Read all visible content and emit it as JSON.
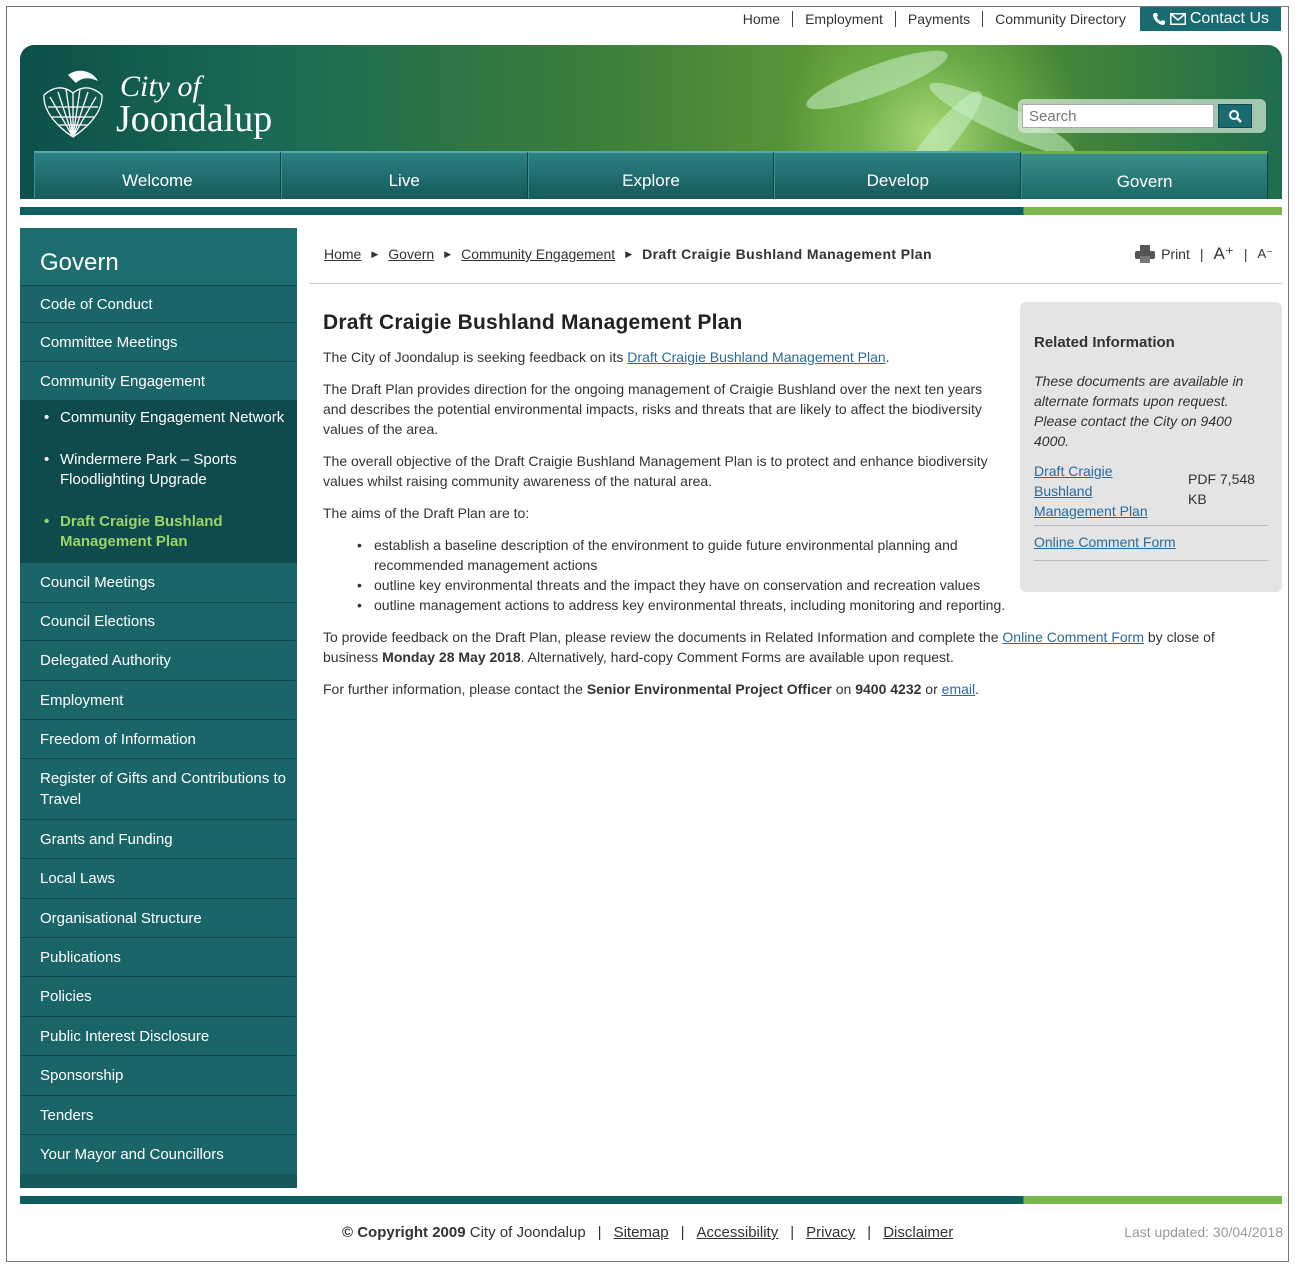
{
  "utility_nav": {
    "items": [
      "Home",
      "Employment",
      "Payments",
      "Community Directory"
    ],
    "contact": "Contact Us"
  },
  "logo": {
    "line1": "City of",
    "line2": "Joondalup"
  },
  "search": {
    "placeholder": "Search"
  },
  "main_nav": {
    "items": [
      "Welcome",
      "Live",
      "Explore",
      "Develop",
      "Govern"
    ],
    "active": "Govern"
  },
  "sidebar": {
    "title": "Govern",
    "items": [
      "Code of Conduct",
      "Committee Meetings",
      "Community Engagement"
    ],
    "sub_items": [
      "Community Engagement Network",
      "Windermere Park – Sports Floodlighting Upgrade",
      "Draft Craigie Bushland Management Plan"
    ],
    "items_after": [
      "Council Meetings",
      "Council Elections",
      "Delegated Authority",
      "Employment",
      "Freedom of Information",
      "Register of Gifts and Contributions to Travel",
      "Grants and Funding",
      "Local Laws",
      "Organisational Structure",
      "Publications",
      "Policies",
      "Public Interest Disclosure",
      "Sponsorship",
      "Tenders",
      "Your Mayor and Councillors"
    ]
  },
  "breadcrumb": {
    "items": [
      "Home",
      "Govern",
      "Community Engagement"
    ],
    "current": "Draft Craigie Bushland Management Plan"
  },
  "tools": {
    "print": "Print",
    "increase": "A⁺",
    "decrease": "A⁻"
  },
  "content": {
    "title": "Draft Craigie Bushland Management Plan",
    "p1_text": "The City of Joondalup is seeking feedback on its ",
    "p1_link": "Draft Craigie Bushland Management Plan",
    "p1_end": ".",
    "p2": "The Draft Plan provides direction for the ongoing management of Craigie Bushland over the next ten years and describes the potential environmental impacts, risks and threats that are likely to affect the biodiversity values of the area.",
    "p3": "The overall objective of the Draft Craigie Bushland Management Plan is to protect and enhance biodiversity values whilst raising community awareness of the natural area.",
    "p4": "The aims of the Draft Plan are to:",
    "aims": [
      "establish a baseline description of the environment to guide future environmental planning and recommended management actions",
      "outline key environmental threats and the impact they have on conservation and recreation values",
      "outline management actions to address key environmental threats, including monitoring and reporting."
    ],
    "p5_a": "To provide feedback on the Draft Plan, please review the documents in Related Information and complete the ",
    "p5_link": "Online Comment Form",
    "p5_b": " by close of business ",
    "p5_bold": "Monday 28 May 2018",
    "p5_c": ". Alternatively, hard-copy Comment Forms are available upon request.",
    "p6_a": "For further information, please contact the ",
    "p6_bold1": "Senior Environmental Project Officer",
    "p6_b": " on ",
    "p6_bold2": "9400 4232",
    "p6_c": " or ",
    "p6_link": "email",
    "p6_d": "."
  },
  "related": {
    "title": "Related Information",
    "note": "These documents are available in alternate formats upon request. Please contact the City on 9400 4000.",
    "doc_link": "Draft Craigie Bushland Management Plan",
    "doc_meta": "PDF 7,548 KB",
    "form_link": "Online Comment Form"
  },
  "footer": {
    "copyright_bold": "© Copyright 2009",
    "copyright_rest": "City of Joondalup",
    "links": [
      "Sitemap",
      "Accessibility",
      "Privacy",
      "Disclaimer"
    ],
    "updated": "Last updated: 30/04/2018"
  },
  "colors": {
    "teal": "#16585a",
    "green_accent": "#7db64a",
    "link": "#2a6a9e"
  },
  "icons": [
    "phone-icon",
    "mail-icon",
    "search-icon",
    "printer-icon"
  ]
}
